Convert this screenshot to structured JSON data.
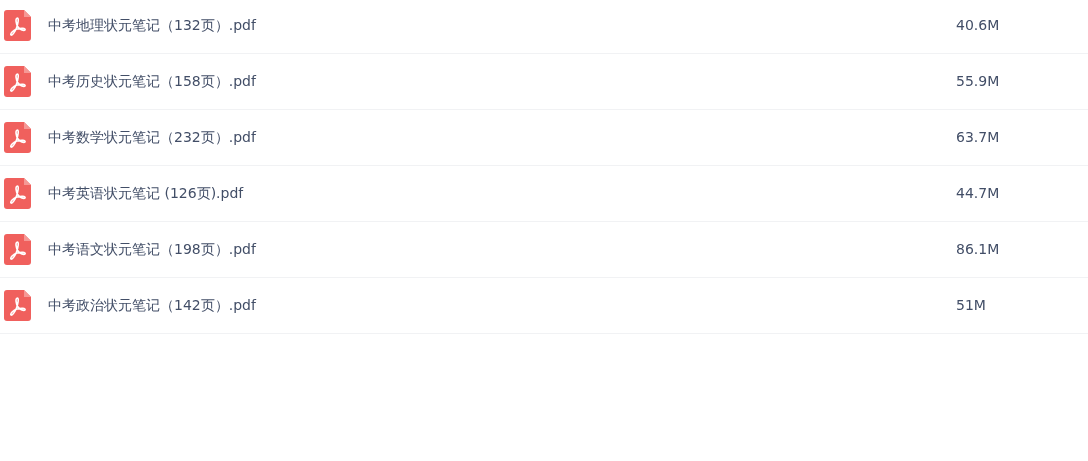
{
  "files": [
    {
      "name": "中考地理状元笔记（132页）.pdf",
      "size": "40.6M"
    },
    {
      "name": "中考历史状元笔记（158页）.pdf",
      "size": "55.9M"
    },
    {
      "name": "中考数学状元笔记（232页）.pdf",
      "size": "63.7M"
    },
    {
      "name": "中考英语状元笔记 (126页).pdf",
      "size": "44.7M"
    },
    {
      "name": "中考语文状元笔记（198页）.pdf",
      "size": "86.1M"
    },
    {
      "name": "中考政治状元笔记（142页）.pdf",
      "size": "51M"
    }
  ]
}
